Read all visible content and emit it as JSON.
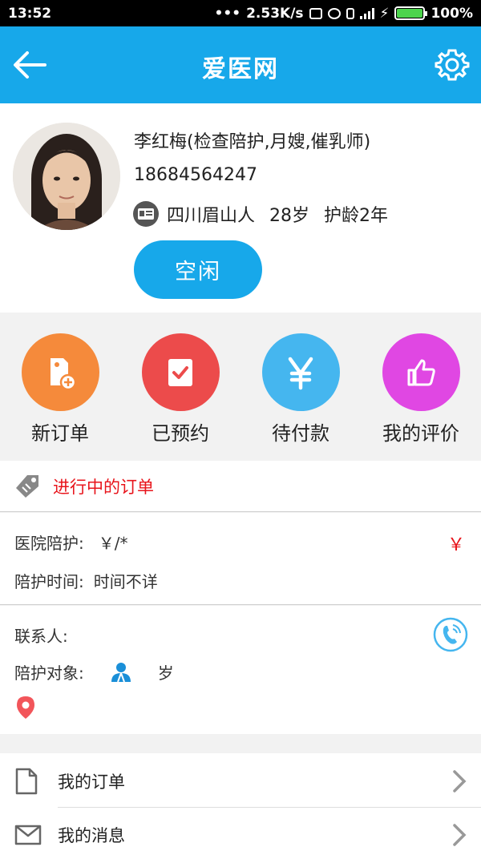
{
  "status_bar": {
    "time": "13:52",
    "network_speed": "2.53K/s",
    "battery": "100%",
    "battery_level": 1.0
  },
  "header": {
    "title": "爱医网",
    "back_icon": "arrow-left-icon",
    "settings_icon": "gear-icon"
  },
  "profile": {
    "name": "李红梅(检查陪护,月嫂,催乳师)",
    "phone": "18684564247",
    "hometown": "四川眉山人",
    "age": "28岁",
    "experience": "护龄2年",
    "status_button": "空闲"
  },
  "quick_actions": [
    {
      "label": "新订单",
      "icon": "new-order-icon",
      "color": "#f58a3b"
    },
    {
      "label": "已预约",
      "icon": "booked-icon",
      "color": "#ec4b4b"
    },
    {
      "label": "待付款",
      "icon": "yen-icon",
      "color": "#45b6ef"
    },
    {
      "label": "我的评价",
      "icon": "thumbs-up-icon",
      "color": "#e047e3"
    }
  ],
  "current_orders": {
    "heading": "进行中的订单",
    "service_label": "医院陪护:",
    "service_value": "￥/*",
    "price": "￥",
    "time_label": "陪护时间:",
    "time_value": "时间不详",
    "contact_label": "联系人:",
    "target_label": "陪护对象:",
    "target_age": "岁"
  },
  "menu": [
    {
      "label": "我的订单",
      "icon": "document-icon"
    },
    {
      "label": "我的消息",
      "icon": "envelope-icon"
    }
  ],
  "colors": {
    "brand_blue": "#17a8ea",
    "alert_red": "#e8141b"
  }
}
